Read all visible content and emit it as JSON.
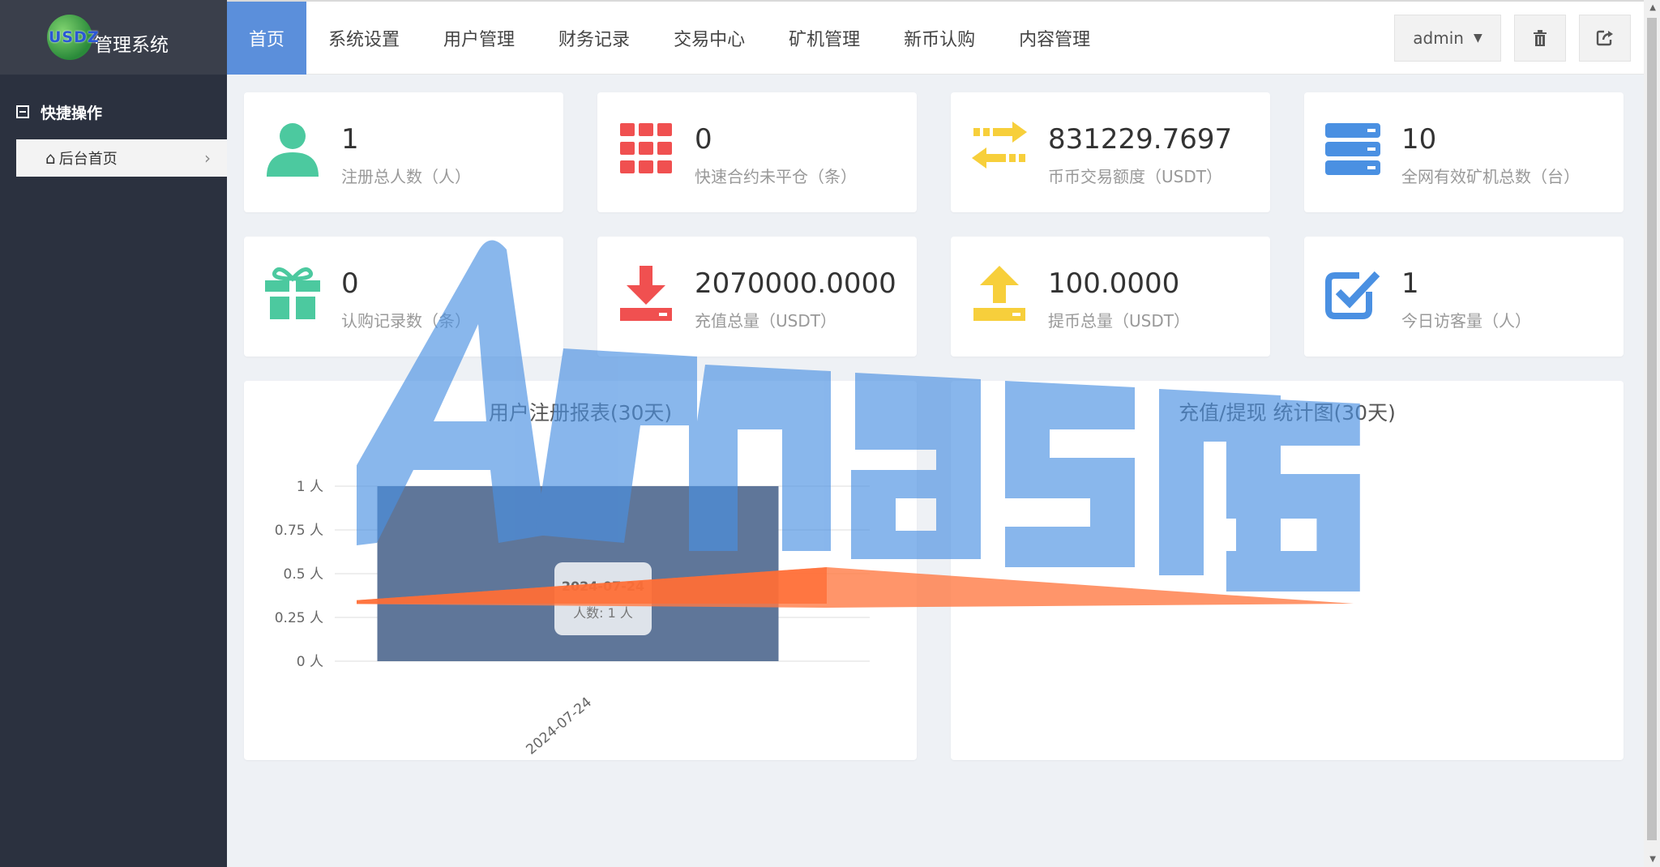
{
  "app": {
    "logo_word": "USDZ",
    "logo_title": "管理系统"
  },
  "sidebar": {
    "section_title": "快捷操作",
    "items": [
      {
        "label": "后台首页",
        "icon": "home-icon"
      }
    ]
  },
  "nav": {
    "tabs": [
      {
        "label": "首页",
        "active": true
      },
      {
        "label": "系统设置"
      },
      {
        "label": "用户管理"
      },
      {
        "label": "财务记录"
      },
      {
        "label": "交易中心"
      },
      {
        "label": "矿机管理"
      },
      {
        "label": "新币认购"
      },
      {
        "label": "内容管理"
      }
    ],
    "user": "admin",
    "icons": [
      "trash-icon",
      "logout-icon"
    ]
  },
  "stats": [
    {
      "value": "1",
      "label": "注册总人数（人）",
      "icon": "user-icon",
      "color": "#4cc99f"
    },
    {
      "value": "0",
      "label": "快速合约未平仓（条）",
      "icon": "grid-icon",
      "color": "#f05050"
    },
    {
      "value": "831229.7697",
      "label": "币币交易额度（USDT）",
      "icon": "exchange-icon",
      "color": "#f7cf3b"
    },
    {
      "value": "10",
      "label": "全网有效矿机总数（台）",
      "icon": "server-icon",
      "color": "#4a90e2"
    },
    {
      "value": "0",
      "label": "认购记录数（条）",
      "icon": "gift-icon",
      "color": "#4cc99f"
    },
    {
      "value": "2070000.0000",
      "label": "充值总量（USDT）",
      "icon": "download-icon",
      "color": "#f05050"
    },
    {
      "value": "100.0000",
      "label": "提币总量（USDT）",
      "icon": "upload-icon",
      "color": "#f7cf3b"
    },
    {
      "value": "1",
      "label": "今日访客量（人）",
      "icon": "check-square-icon",
      "color": "#4a90e2"
    }
  ],
  "charts": {
    "left_title": "用户注册报表(30天)",
    "right_title": "充值/提现 统计图(30天)",
    "tooltip": {
      "date": "2024-07-24",
      "label": "人数: 1 人"
    }
  },
  "chart_data": [
    {
      "type": "bar",
      "title": "用户注册报表(30天)",
      "categories": [
        "2024-07-24"
      ],
      "values": [
        1
      ],
      "ylim": [
        0,
        1
      ],
      "yticks": [
        "0 人",
        "0.25 人",
        "0.5 人",
        "0.75 人",
        "1 人"
      ],
      "grid": true
    },
    {
      "type": "bar",
      "title": "充值/提现 统计图(30天)",
      "categories": [],
      "values": []
    }
  ],
  "watermark": {
    "text": "Amasns"
  },
  "colors": {
    "accent": "#5b8fdb",
    "sidebar": "#2b313f",
    "bar": "#5f7699"
  }
}
